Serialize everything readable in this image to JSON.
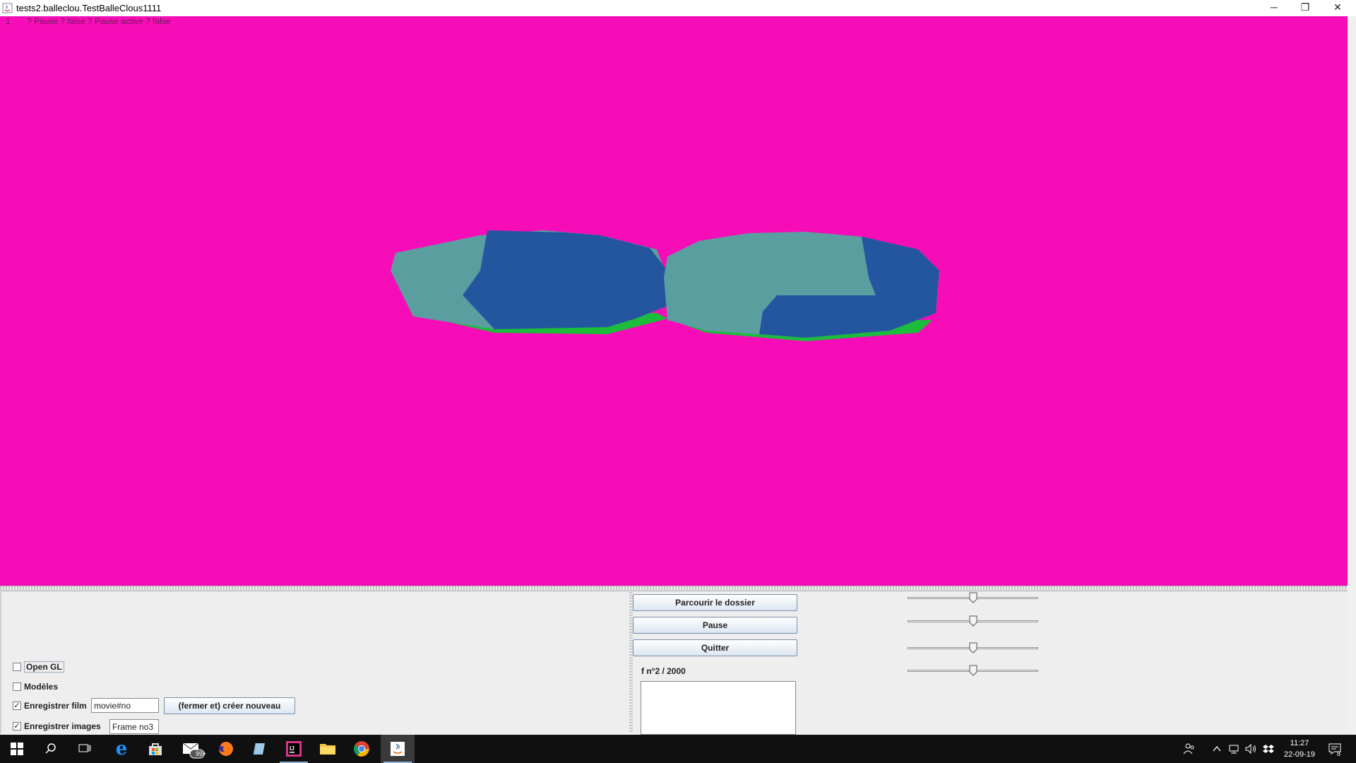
{
  "window": {
    "title": "tests2.balleclou.TestBalleClous1111",
    "minimize_glyph": "─",
    "restore_glyph": "❐",
    "close_glyph": "✕"
  },
  "canvas": {
    "background": "#f70db7",
    "overlay_text": "1       ? Pause ? false ? Pause active ? false"
  },
  "controls": {
    "open_gl_label": "Open GL",
    "modeles_label": "Modèles",
    "enregistrer_film_label": "Enregistrer film",
    "movie_field_value": "movie#no",
    "create_new_button": "(fermer et) créer nouveau",
    "enregistrer_images_label": "Enregistrer images",
    "frame_field_value": "Frame no3",
    "open_gl_checked": false,
    "modeles_checked": false,
    "enregistrer_film_checked": true,
    "enregistrer_images_checked": true,
    "checked_glyph": "✓"
  },
  "buttons": {
    "browse": "Parcourir le dossier",
    "pause": "Pause",
    "quit": "Quitter"
  },
  "frame_counter": "f n°2 / 2000",
  "sliders": [
    0.5,
    0.5,
    0.5,
    0.5
  ],
  "taskbar": {
    "mail_badge": "99+",
    "time": "11:27",
    "date": "22-09-19",
    "notification_count": "8"
  }
}
